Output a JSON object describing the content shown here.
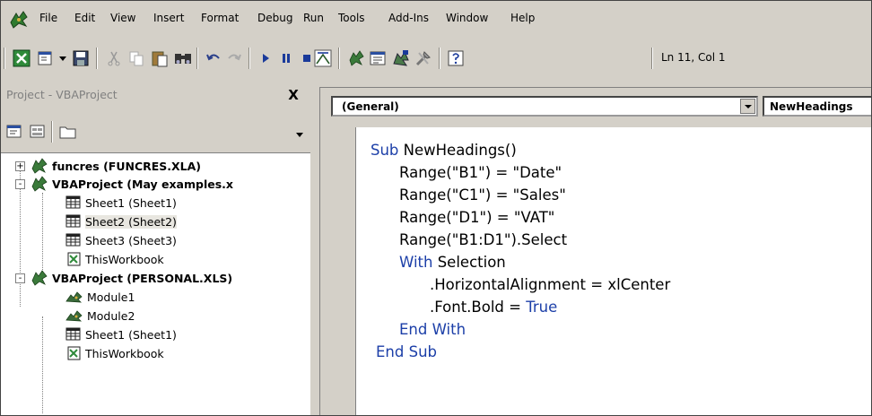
{
  "menu": {
    "items": [
      "File",
      "Edit",
      "View",
      "Insert",
      "Format",
      "Debug",
      "Run",
      "Tools",
      "Add-Ins",
      "Window",
      "Help"
    ]
  },
  "toolbar": {
    "cursor_position": "Ln 11, Col 1"
  },
  "project": {
    "title": "Project - VBAProject",
    "close_label": "X",
    "tree": [
      {
        "label": "funcres (FUNCRES.XLA)",
        "bold": true,
        "expander": "+"
      },
      {
        "label": "VBAProject (May examples.x",
        "bold": true,
        "expander": "-"
      },
      {
        "label": "Sheet1 (Sheet1)"
      },
      {
        "label": "Sheet2 (Sheet2)",
        "selected": true
      },
      {
        "label": "Sheet3 (Sheet3)"
      },
      {
        "label": "ThisWorkbook"
      },
      {
        "label": "VBAProject (PERSONAL.XLS)",
        "bold": true,
        "expander": "-"
      },
      {
        "label": "Module1"
      },
      {
        "label": "Module2"
      },
      {
        "label": "Sheet1 (Sheet1)"
      },
      {
        "label": "ThisWorkbook"
      }
    ]
  },
  "code": {
    "object_dropdown": "(General)",
    "procedure_dropdown": "NewHeadings",
    "lines": {
      "l1_kw": "Sub",
      "l1_rest": " NewHeadings()",
      "l2": "Range(\"B1\") = \"Date\"",
      "l3": "Range(\"C1\") = \"Sales\"",
      "l4": "Range(\"D1\") = \"VAT\"",
      "l5": "Range(\"B1:D1\").Select",
      "l6_kw": "With",
      "l6_rest": " Selection",
      "l7": ".HorizontalAlignment = xlCenter",
      "l8_a": ".Font.Bold = ",
      "l8_kw": "True",
      "l9_kw": "End With",
      "l10_kw": "End Sub"
    }
  },
  "colors": {
    "keyword": "#1c3fa8",
    "chrome": "#d4d0c8"
  }
}
